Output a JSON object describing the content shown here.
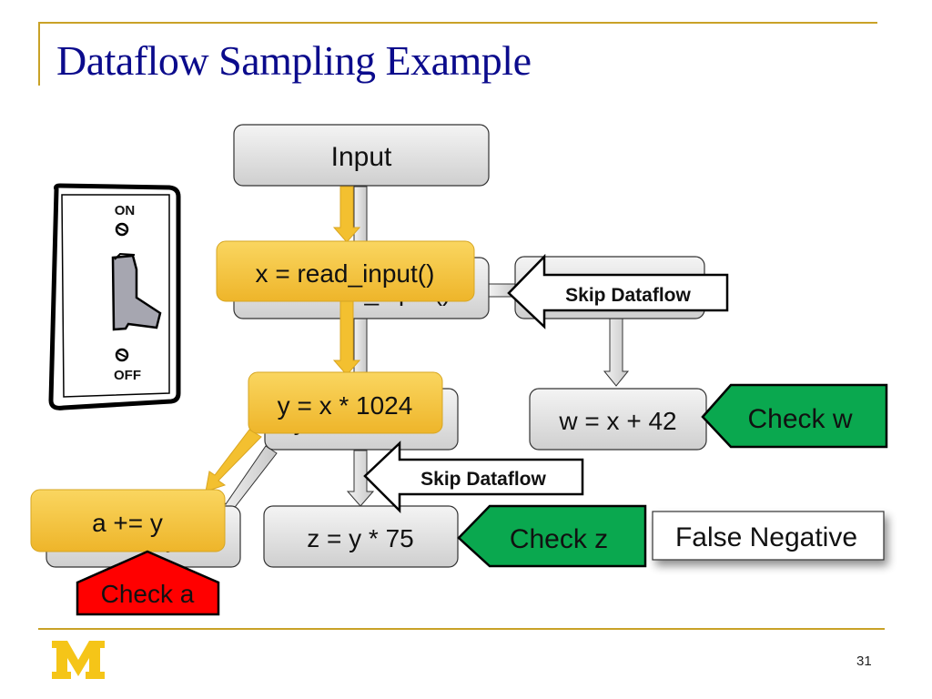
{
  "slide": {
    "title": "Dataflow Sampling Example",
    "page_number": "31",
    "logo": "M",
    "colors": {
      "title": "#0b0b8c",
      "accent_rule": "#c9a227",
      "yellow_node": "#f5c33b",
      "gray_node": "#dedede",
      "check_green": "#0aa84f",
      "check_red": "#ff0000",
      "logo": "#f5c518"
    }
  },
  "switch": {
    "on_label": "ON",
    "off_label": "OFF",
    "state": "off"
  },
  "nodes": {
    "input": "Input",
    "read_input_gray": "x = read_input()",
    "read_input_yellow": "x = read_input()",
    "y_gray": "y = x * 1024",
    "y_yellow": "y = x * 1024",
    "w_gray": "w = x + 42",
    "a_gray": "a += y",
    "a_yellow": "a += y",
    "z_gray": "z = y * 75"
  },
  "callouts": {
    "skip_dataflow_1": "Skip Dataflow",
    "skip_dataflow_2": "Skip Dataflow",
    "check_w": "Check w",
    "check_z": "Check z",
    "check_a": "Check a",
    "false_negative": "False Negative"
  }
}
